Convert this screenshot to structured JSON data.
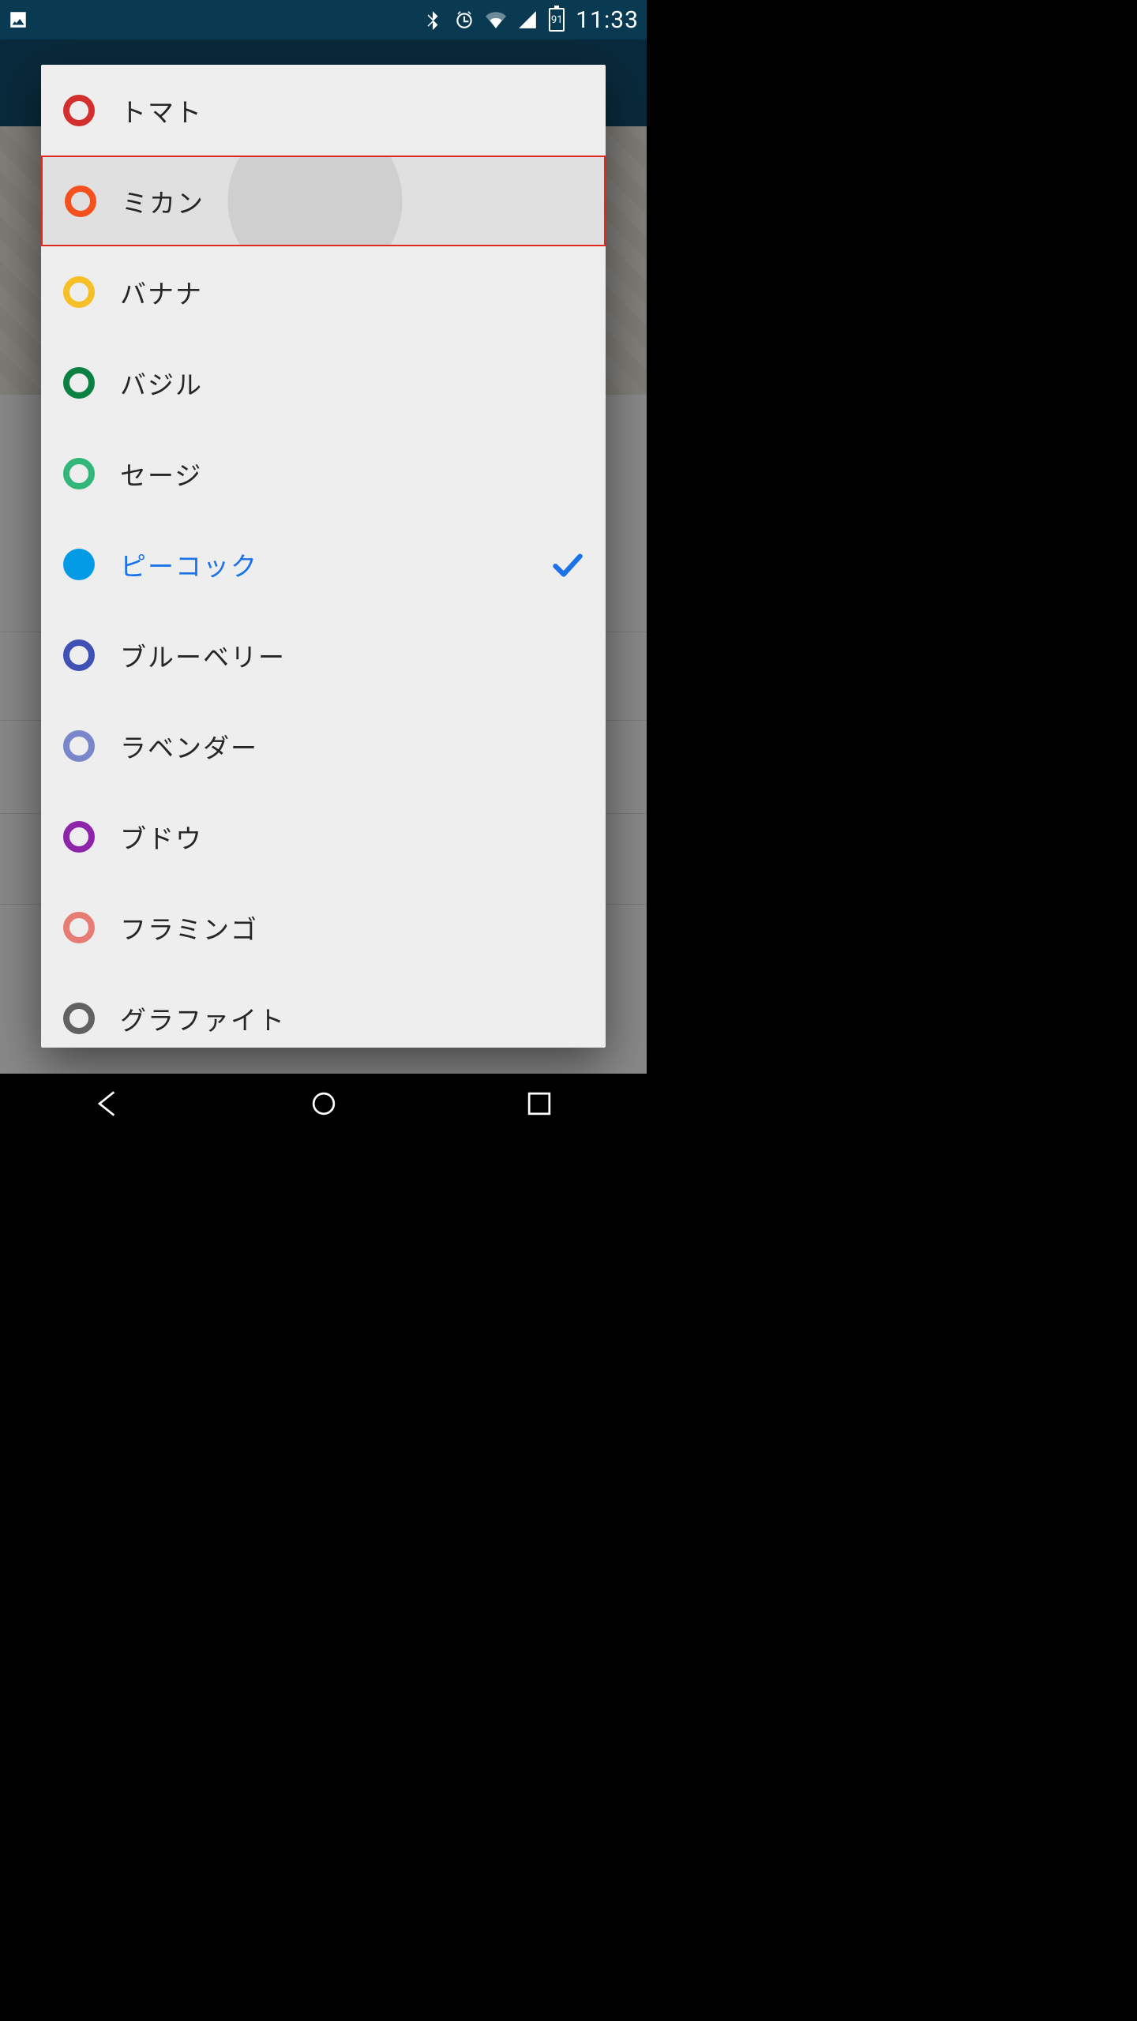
{
  "status_bar": {
    "time": "11:33",
    "battery_level": "91",
    "icons": [
      "image-icon",
      "bluetooth-icon",
      "alarm-icon",
      "wifi-icon",
      "signal-icon",
      "battery-icon"
    ]
  },
  "dialog": {
    "highlighted_index": 1,
    "selected_index": 5,
    "items": [
      {
        "label": "トマト",
        "color": "#d32f2f",
        "variant": "open"
      },
      {
        "label": "ミカン",
        "color": "#f4511e",
        "variant": "open"
      },
      {
        "label": "バナナ",
        "color": "#f6bf26",
        "variant": "open"
      },
      {
        "label": "バジル",
        "color": "#0b8043",
        "variant": "open"
      },
      {
        "label": "セージ",
        "color": "#33b679",
        "variant": "open"
      },
      {
        "label": "ピーコック",
        "color": "#039be5",
        "variant": "fill"
      },
      {
        "label": "ブルーベリー",
        "color": "#3f51b5",
        "variant": "open"
      },
      {
        "label": "ラベンダー",
        "color": "#7986cb",
        "variant": "open"
      },
      {
        "label": "ブドウ",
        "color": "#8e24aa",
        "variant": "open"
      },
      {
        "label": "フラミンゴ",
        "color": "#e67c73",
        "variant": "open"
      },
      {
        "label": "グラファイト",
        "color": "#616161",
        "variant": "open"
      }
    ]
  }
}
